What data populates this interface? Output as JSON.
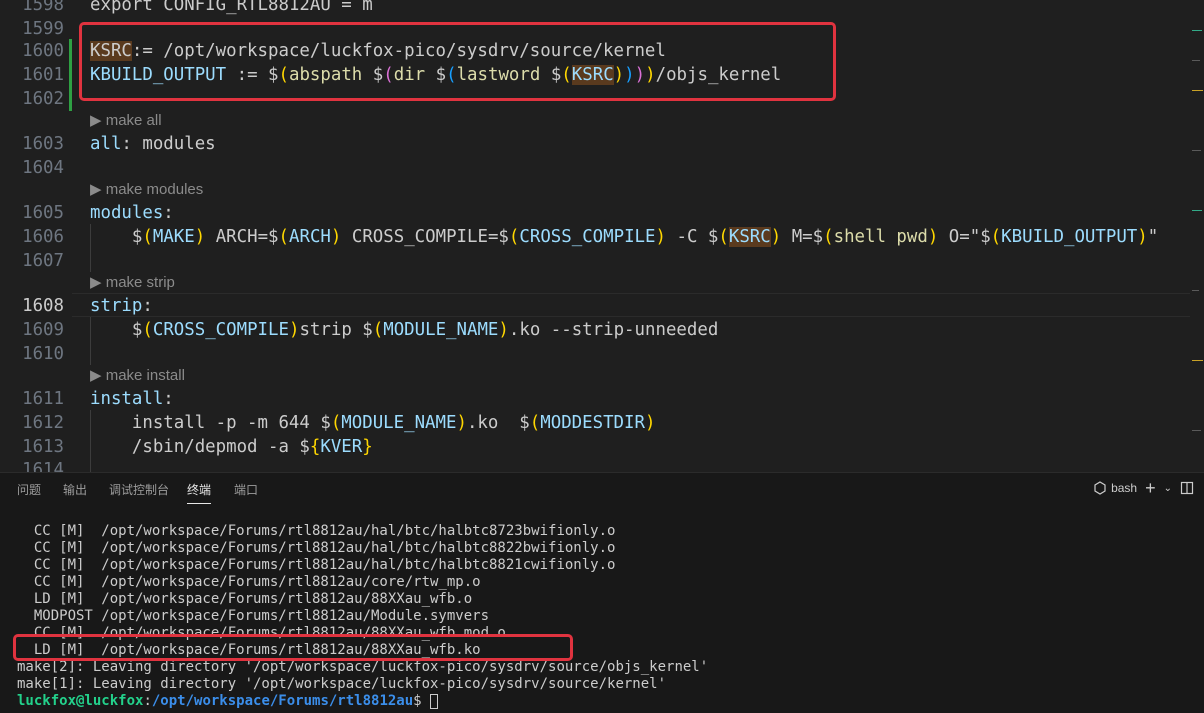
{
  "editor": {
    "lines": [
      {
        "n": "1598",
        "segs": [
          {
            "t": "export CONFIG_RTL8812AU = m",
            "c": "plain"
          }
        ]
      },
      {
        "n": "1599",
        "segs": []
      },
      {
        "n": "1600",
        "segs": [
          {
            "t": "KSRC",
            "c": "mark"
          },
          {
            "t": ":= /opt/workspace/luckfox-pico/sysdrv/source/kernel",
            "c": "plain"
          }
        ]
      },
      {
        "n": "1601",
        "segs": [
          {
            "t": "KBUILD_OUTPUT",
            "c": "var"
          },
          {
            "t": " := ",
            "c": "plain"
          },
          {
            "t": "$",
            "c": "plain"
          },
          {
            "t": "(",
            "c": "gold"
          },
          {
            "t": "abspath ",
            "c": "fn"
          },
          {
            "t": "$",
            "c": "plain"
          },
          {
            "t": "(",
            "c": "pink"
          },
          {
            "t": "dir ",
            "c": "fn"
          },
          {
            "t": "$",
            "c": "plain"
          },
          {
            "t": "(",
            "c": "blue"
          },
          {
            "t": "lastword ",
            "c": "fn"
          },
          {
            "t": "$",
            "c": "plain"
          },
          {
            "t": "(",
            "c": "gold"
          },
          {
            "t": "KSRC",
            "c": "markvar"
          },
          {
            "t": ")",
            "c": "gold"
          },
          {
            "t": ")",
            "c": "blue"
          },
          {
            "t": ")",
            "c": "pink"
          },
          {
            "t": ")",
            "c": "gold"
          },
          {
            "t": "/objs_kernel",
            "c": "plain"
          }
        ]
      },
      {
        "n": "1602",
        "segs": []
      },
      {
        "n": "1603",
        "segs": [
          {
            "t": "all",
            "c": "var"
          },
          {
            "t": ": modules",
            "c": "plain"
          }
        ]
      },
      {
        "n": "1604",
        "segs": []
      },
      {
        "n": "1605",
        "segs": [
          {
            "t": "modules",
            "c": "var"
          },
          {
            "t": ":",
            "c": "plain"
          }
        ]
      },
      {
        "n": "1606",
        "segs": [
          {
            "t": "    $",
            "c": "plain"
          },
          {
            "t": "(",
            "c": "gold"
          },
          {
            "t": "MAKE",
            "c": "var"
          },
          {
            "t": ")",
            "c": "gold"
          },
          {
            "t": " ARCH=$",
            "c": "plain"
          },
          {
            "t": "(",
            "c": "gold"
          },
          {
            "t": "ARCH",
            "c": "var"
          },
          {
            "t": ")",
            "c": "gold"
          },
          {
            "t": " CROSS_COMPILE=$",
            "c": "plain"
          },
          {
            "t": "(",
            "c": "gold"
          },
          {
            "t": "CROSS_COMPILE",
            "c": "var"
          },
          {
            "t": ")",
            "c": "gold"
          },
          {
            "t": " -C $",
            "c": "plain"
          },
          {
            "t": "(",
            "c": "gold"
          },
          {
            "t": "KSRC",
            "c": "markvar"
          },
          {
            "t": ")",
            "c": "gold"
          },
          {
            "t": " M=$",
            "c": "plain"
          },
          {
            "t": "(",
            "c": "gold"
          },
          {
            "t": "shell pwd",
            "c": "fn"
          },
          {
            "t": ")",
            "c": "gold"
          },
          {
            "t": " O=\"$",
            "c": "plain"
          },
          {
            "t": "(",
            "c": "gold"
          },
          {
            "t": "KBUILD_OUTPUT",
            "c": "var"
          },
          {
            "t": ")",
            "c": "gold"
          },
          {
            "t": "\"",
            "c": "plain"
          }
        ]
      },
      {
        "n": "1607",
        "segs": []
      },
      {
        "n": "1608",
        "segs": [
          {
            "t": "strip",
            "c": "var"
          },
          {
            "t": ":",
            "c": "plain"
          }
        ]
      },
      {
        "n": "1609",
        "segs": [
          {
            "t": "    $",
            "c": "plain"
          },
          {
            "t": "(",
            "c": "gold"
          },
          {
            "t": "CROSS_COMPILE",
            "c": "var"
          },
          {
            "t": ")",
            "c": "gold"
          },
          {
            "t": "strip $",
            "c": "plain"
          },
          {
            "t": "(",
            "c": "gold"
          },
          {
            "t": "MODULE_NAME",
            "c": "var"
          },
          {
            "t": ")",
            "c": "gold"
          },
          {
            "t": ".ko --strip-unneeded",
            "c": "plain"
          }
        ]
      },
      {
        "n": "1610",
        "segs": []
      },
      {
        "n": "1611",
        "segs": [
          {
            "t": "install",
            "c": "var"
          },
          {
            "t": ":",
            "c": "plain"
          }
        ]
      },
      {
        "n": "1612",
        "segs": [
          {
            "t": "    install -p -m 644 $",
            "c": "plain"
          },
          {
            "t": "(",
            "c": "gold"
          },
          {
            "t": "MODULE_NAME",
            "c": "var"
          },
          {
            "t": ")",
            "c": "gold"
          },
          {
            "t": ".ko  $",
            "c": "plain"
          },
          {
            "t": "(",
            "c": "gold"
          },
          {
            "t": "MODDESTDIR",
            "c": "var"
          },
          {
            "t": ")",
            "c": "gold"
          }
        ]
      },
      {
        "n": "1613",
        "segs": [
          {
            "t": "    /sbin/depmod -a $",
            "c": "plain"
          },
          {
            "t": "{",
            "c": "gold"
          },
          {
            "t": "KVER",
            "c": "var"
          },
          {
            "t": "}",
            "c": "gold"
          }
        ]
      },
      {
        "n": "1614",
        "segs": []
      }
    ],
    "codelens": {
      "make_all": "▶ make all",
      "make_modules": "▶ make modules",
      "make_strip": "▶ make strip",
      "make_install": "▶ make install"
    }
  },
  "panel": {
    "tabs": [
      "问题",
      "输出",
      "调试控制台",
      "终端",
      "端口"
    ],
    "active_tab": "终端",
    "shell_label": "bash",
    "terminal_lines": [
      "  CC [M]  /opt/workspace/Forums/rtl8812au/hal/btc/halbtc8723bwifionly.o",
      "  CC [M]  /opt/workspace/Forums/rtl8812au/hal/btc/halbtc8822bwifionly.o",
      "  CC [M]  /opt/workspace/Forums/rtl8812au/hal/btc/halbtc8821cwifionly.o",
      "  CC [M]  /opt/workspace/Forums/rtl8812au/core/rtw_mp.o",
      "  LD [M]  /opt/workspace/Forums/rtl8812au/88XXau_wfb.o",
      "  MODPOST /opt/workspace/Forums/rtl8812au/Module.symvers",
      "  CC [M]  /opt/workspace/Forums/rtl8812au/88XXau_wfb.mod.o",
      "  LD [M]  /opt/workspace/Forums/rtl8812au/88XXau_wfb.ko",
      "make[2]: Leaving directory '/opt/workspace/luckfox-pico/sysdrv/source/objs_kernel'",
      "make[1]: Leaving directory '/opt/workspace/luckfox-pico/sysdrv/source/kernel'"
    ],
    "prompt": {
      "user": "luckfox@luckfox",
      "sep": ":",
      "path": "/opt/workspace/Forums/rtl8812au",
      "symbol": "$ "
    }
  },
  "colors": {
    "highlight_box": "#e0333f",
    "terminal_user": "#23d18b",
    "terminal_path": "#3b8eea"
  }
}
